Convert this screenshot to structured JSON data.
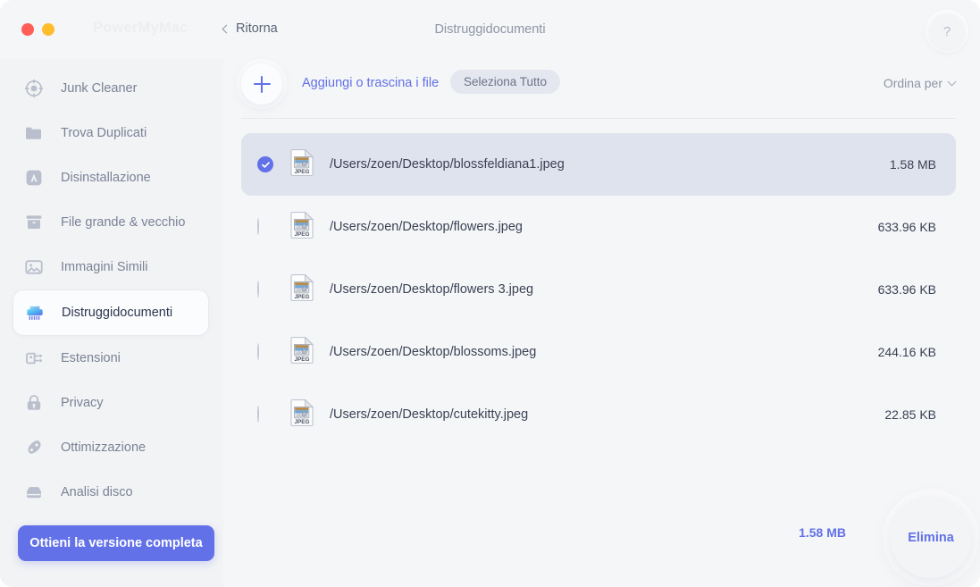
{
  "window": {
    "brand": "PowerMyMac",
    "back_label": "Ritorna",
    "title": "Distruggidocumenti",
    "help_label": "?"
  },
  "sidebar": {
    "items": [
      {
        "label": "Junk Cleaner",
        "icon": "junk-cleaner-icon",
        "active": false
      },
      {
        "label": "Trova Duplicati",
        "icon": "folder-icon",
        "active": false
      },
      {
        "label": "Disinstallazione",
        "icon": "app-store-icon",
        "active": false
      },
      {
        "label": "File grande & vecchio",
        "icon": "archive-box-icon",
        "active": false
      },
      {
        "label": "Immagini Simili",
        "icon": "photo-icon",
        "active": false
      },
      {
        "label": "Distruggidocumenti",
        "icon": "shredder-icon",
        "active": true
      },
      {
        "label": "Estensioni",
        "icon": "plug-icon",
        "active": false
      },
      {
        "label": "Privacy",
        "icon": "lock-icon",
        "active": false
      },
      {
        "label": "Ottimizzazione",
        "icon": "rocket-icon",
        "active": false
      },
      {
        "label": "Analisi disco",
        "icon": "hard-drive-icon",
        "active": false
      }
    ],
    "upgrade_label": "Ottieni la versione completa"
  },
  "toolbar": {
    "add_label": "Aggiungi o trascina i file",
    "select_all_label": "Seleziona Tutto",
    "sort_label": "Ordina per"
  },
  "files": [
    {
      "path": "/Users/zoen/Desktop/blossfeldiana1.jpeg",
      "size": "1.58 MB",
      "selected": true,
      "type": "JPEG"
    },
    {
      "path": "/Users/zoen/Desktop/flowers.jpeg",
      "size": "633.96 KB",
      "selected": false,
      "type": "JPEG"
    },
    {
      "path": "/Users/zoen/Desktop/flowers 3.jpeg",
      "size": "633.96 KB",
      "selected": false,
      "type": "JPEG"
    },
    {
      "path": "/Users/zoen/Desktop/blossoms.jpeg",
      "size": "244.16 KB",
      "selected": false,
      "type": "JPEG"
    },
    {
      "path": "/Users/zoen/Desktop/cutekitty.jpeg",
      "size": "22.85 KB",
      "selected": false,
      "type": "JPEG"
    }
  ],
  "footer": {
    "total_size": "1.58 MB",
    "delete_label": "Elimina"
  },
  "colors": {
    "accent": "#6271e8",
    "selected_row": "#dfe3ed",
    "sidebar_bg": "#f2f3f5",
    "main_bg": "#f5f6f7",
    "traffic_red": "#ff5f56",
    "traffic_yellow": "#ffbd2e",
    "text_primary": "#3b4256",
    "text_muted": "#8e95a6"
  }
}
